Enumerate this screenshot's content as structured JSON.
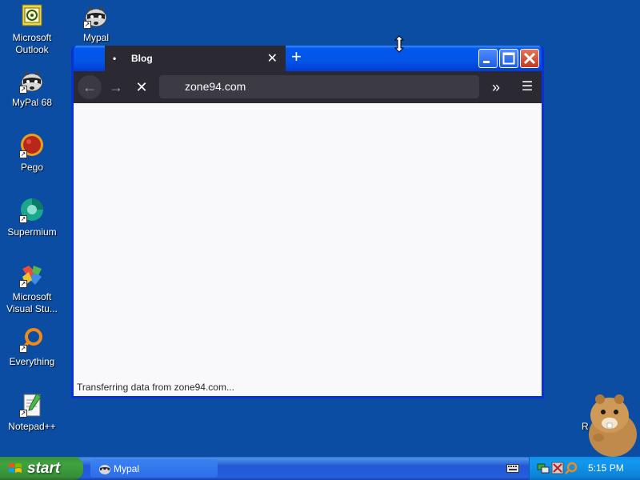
{
  "desktop": {
    "icons": [
      {
        "label": "Microsoft Outlook",
        "icon": "outlook-icon"
      },
      {
        "label": "Mypal",
        "icon": "mypal-raccoon-icon"
      },
      {
        "label": "MyPal 68",
        "icon": "mypal-raccoon-icon"
      },
      {
        "label": "Pego",
        "icon": "pego-icon"
      },
      {
        "label": "Supermium",
        "icon": "supermium-icon"
      },
      {
        "label": "Microsoft Visual Stu...",
        "icon": "visual-studio-icon"
      },
      {
        "label": "Everything",
        "icon": "everything-icon"
      },
      {
        "label": "Notepad++",
        "icon": "notepadpp-icon"
      }
    ],
    "partial_label": "R"
  },
  "browser": {
    "tab_title": "Blog",
    "tab_indicator": "•",
    "url": "zone94.com",
    "status_text": "Transferring data from zone94.com...",
    "colors": {
      "chrome": "#2b2a33",
      "urlbar": "#3c3b44",
      "content_bg": "#f9f9fb",
      "xp_title_blue": "#0058ee",
      "close_red": "#c4391c"
    }
  },
  "taskbar": {
    "start_label": "start",
    "task_button_label": "Mypal",
    "clock": "5:15 PM",
    "tray_icons": [
      "network-icon",
      "security-icon",
      "search-icon"
    ]
  }
}
